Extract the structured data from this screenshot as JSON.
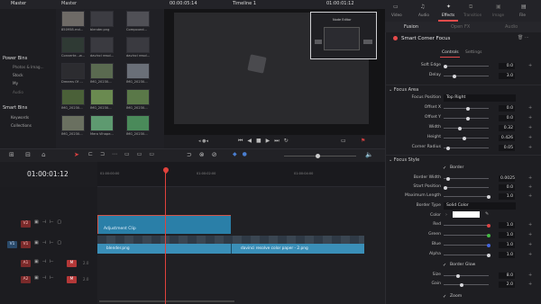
{
  "media_pool": {
    "master_tab": "Master",
    "bin_header": "Master",
    "power_bins": "Power Bins",
    "power_items": [
      "Photos & Imag...",
      "Stock",
      "My",
      "Audio"
    ],
    "smart_bins": "Smart Bins",
    "smart_items": [
      "Keywords",
      "Collections"
    ],
    "clips": [
      [
        "850958.rnd...",
        "blender.png",
        "Compound..."
      ],
      [
        "Converte...w...",
        "davinci resol...",
        "davinci resol..."
      ],
      [
        "Dreams Of ...",
        "IMG_20230...",
        "IMG_20230..."
      ],
      [
        "IMG_20230...",
        "IMG_20230...",
        "IMG_20230..."
      ],
      [
        "IMG_20230...",
        "Mero Vihape...",
        "IMG_20230..."
      ]
    ]
  },
  "viewer": {
    "timecode_left": "00:00:05:14",
    "timeline_name": "Timeline 1",
    "timecode_right": "01:00:01:12",
    "zoom": "Fit",
    "node_label": "Node Editor",
    "mediaout": "MediaOut1"
  },
  "timeline": {
    "timecode": "01:00:01:12",
    "ruler": [
      "01:00:00:00",
      "01:00:02:00",
      "01:00:04:00"
    ],
    "tracks": [
      {
        "id": "V2"
      },
      {
        "id": "V1"
      },
      {
        "id": "A1",
        "vol": "2.0"
      },
      {
        "id": "A2",
        "vol": "2.0"
      }
    ],
    "clips": {
      "adjustment": "Adjustment Clip",
      "blender": "blender.png",
      "davinci": "davinci resolve color paper - 2.png"
    }
  },
  "inspector": {
    "tabs": [
      "Video",
      "Audio",
      "Effects",
      "Transition",
      "Image",
      "File"
    ],
    "active_tab": "Effects",
    "subtabs": [
      "Fusion",
      "Open FX",
      "Audio"
    ],
    "effect_name": "Smart Corner Focus",
    "controls_tabs": [
      "Controls",
      "Settings"
    ],
    "params_top": [
      {
        "label": "Soft Edge",
        "value": "0.0"
      },
      {
        "label": "Delay",
        "value": "3.0"
      }
    ],
    "focus_area_title": "Focus Area",
    "focus_position_label": "Focus Position",
    "focus_position": "Top Right",
    "focus_params": [
      {
        "label": "Offset X",
        "value": "0.0"
      },
      {
        "label": "Offset Y",
        "value": "0.0"
      },
      {
        "label": "Width",
        "value": "0.32"
      },
      {
        "label": "Height",
        "value": "0.426"
      },
      {
        "label": "Corner Radius",
        "value": "0.05"
      }
    ],
    "focus_style_title": "Focus Style",
    "border_check": "Border",
    "style_params": [
      {
        "label": "Border Width",
        "value": "0.0025"
      },
      {
        "label": "Start Position",
        "value": "0.0"
      },
      {
        "label": "Maximum Length",
        "value": "1.0"
      }
    ],
    "border_type_label": "Border Type",
    "border_type": "Solid Color",
    "color_label": "Color",
    "rgba": [
      {
        "label": "Red",
        "value": "1.0"
      },
      {
        "label": "Green",
        "value": "1.0"
      },
      {
        "label": "Blue",
        "value": "1.0"
      },
      {
        "label": "Alpha",
        "value": "1.0"
      }
    ],
    "glow_check": "Border Glow",
    "glow_params": [
      {
        "label": "Size",
        "value": "8.0"
      },
      {
        "label": "Gain",
        "value": "2.0"
      }
    ],
    "zoom_check": "Zoom"
  },
  "colors": {
    "accent": "#e64b4b",
    "clip_blue": "#2a7fa8",
    "clip_blue2": "#3a8fb8",
    "playhead": "#e0423c"
  }
}
